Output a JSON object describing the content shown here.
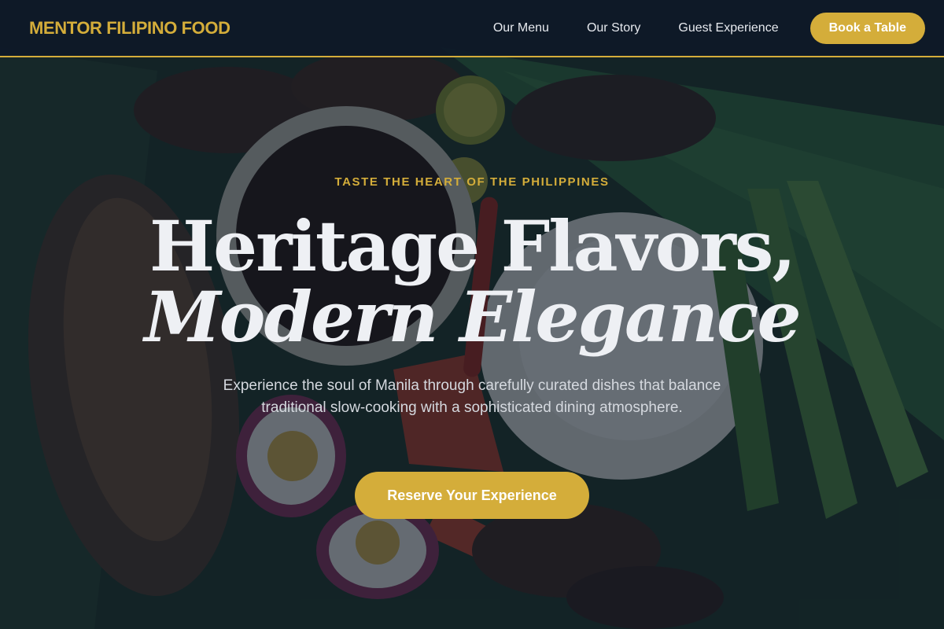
{
  "header": {
    "brand": "MENTOR FILIPINO FOOD",
    "nav": [
      {
        "label": "Our Menu"
      },
      {
        "label": "Our Story"
      },
      {
        "label": "Guest Experience"
      }
    ],
    "book_label": "Book a Table"
  },
  "hero": {
    "eyebrow": "TASTE THE HEART OF THE PHILIPPINES",
    "headline_line1": "Heritage Flavors,",
    "headline_line2": "Modern Elegance",
    "subtitle": "Experience the soul of Manila through carefully curated dishes that balance traditional slow-cooking with a sophisticated dining atmosphere.",
    "cta_label": "Reserve Your Experience",
    "background_image": "filipino-food-spread-photo"
  },
  "colors": {
    "accent": "#d4ad3a",
    "nav_background": "#0e1928",
    "text_light": "#eef0f4"
  }
}
